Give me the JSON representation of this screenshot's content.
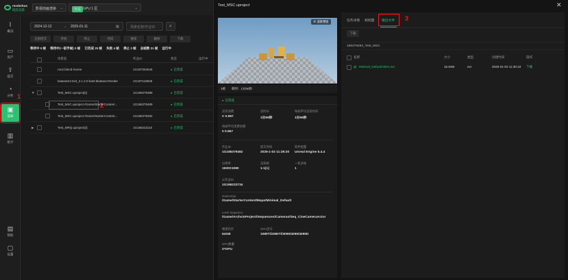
{
  "app": {
    "brand_en": "renderbus",
    "brand_cn": "瑞云渲染",
    "project_select": "影视动画渲染",
    "gpu_tag": "专属",
    "gpu_label": "GPU 1 区"
  },
  "sidebar": {
    "items": [
      {
        "label": "概况",
        "icon": "dashboard-icon"
      },
      {
        "label": "资产",
        "icon": "folder-icon"
      },
      {
        "label": "提交",
        "icon": "upload-icon"
      },
      {
        "label": "分析",
        "icon": "analysis-icon"
      },
      {
        "label": "渲染",
        "icon": "render-icon"
      },
      {
        "label": "统计",
        "icon": "chart-icon"
      },
      {
        "label": "帮助",
        "icon": "help-icon"
      },
      {
        "label": "设置",
        "icon": "settings-icon"
      }
    ]
  },
  "annotations": {
    "n1": "1",
    "n2": "2",
    "n3": "3"
  },
  "filter": {
    "date_from": "2024-12-12",
    "date_arrow": "→",
    "date_to": "2025-01-11",
    "search_placeholder": "场景名称/作业ID"
  },
  "toolbar": [
    "全部提交",
    "开始",
    "停止",
    "完成",
    "重提",
    "删除",
    "下载"
  ],
  "stats": {
    "waiting": "等待中 0 帧",
    "waiting_prev": "等待中(一前手帧) 0 帧",
    "done": "已完成 25 帧",
    "failed": "失败 4 帧",
    "stopped": "停止 2 帧",
    "total": "总帧数 31 帧",
    "running": "运行中"
  },
  "table": {
    "headers": [
      "场景名",
      "作业ID",
      "状态",
      "运行中"
    ],
    "rows": [
      {
        "name": "run2.blend-Scene",
        "id": "1G187253646",
        "status": "已完成",
        "expand": ""
      },
      {
        "name": "katanam3.0v3_2.1.2.0-kat3.6katana-Render",
        "id": "1G187118836",
        "status": "已完成",
        "expand": ""
      },
      {
        "name": "Test_MSC.uproject[2]",
        "id": "1G186379388",
        "status": "已完成",
        "expand": "▼"
      },
      {
        "name": "Test_MSC.uproject-/Game/StarterContent...",
        "id": "1G186379489",
        "status": "已完成",
        "expand": ""
      },
      {
        "name": "Test_MSC.uproject-/Game/StarterContent...",
        "id": "1G186379492",
        "status": "已完成",
        "expand": ""
      },
      {
        "name": "Test_MRQ.uproject[4]",
        "id": "1G186223110",
        "status": "已完成",
        "expand": "▶"
      }
    ]
  },
  "detail": {
    "title": "Test_MSC.uproject",
    "preview_badge": "⊕ 渲染预览",
    "caption_frame": "1帧",
    "caption_time": "耗时：1分56秒",
    "status": "已完成",
    "fields": [
      {
        "k": "实际消费",
        "v": "C 0.967"
      },
      {
        "k": "总时长",
        "v": "1分56秒"
      },
      {
        "k": "每帧平均渲染时间",
        "v": "1分56秒"
      },
      {
        "k": "每帧平均消费金额",
        "v": "¥ 0.967"
      },
      {
        "k": "作业ID",
        "v": "1G186379482"
      },
      {
        "k": "提交时间",
        "v": "2025-1-02 11:28:20"
      },
      {
        "k": "软件配置",
        "v": "Unreal Engine 5.4.4"
      },
      {
        "k": "分辨率",
        "v": "1920X1080"
      },
      {
        "k": "渲染帧",
        "v": "1-1[1]"
      },
      {
        "k": "一机多帧",
        "v": "1"
      },
      {
        "k": "父作业ID",
        "v": "1G186223734"
      },
      {
        "k": "Gamemap",
        "v": "/Game/StarterContent/Maps/Minimal_Default"
      },
      {
        "k": "Level Sequence",
        "v": "/Game/ArchvisProject/Sequences/Cameras/Seq_CineCameraActor"
      },
      {
        "k": "物理内存",
        "v": "64GB"
      },
      {
        "k": "GPU型号",
        "v": "1080Ti/2080Ti/3090/4090/4090D"
      },
      {
        "k": "GPU数量",
        "v": "2*GPU"
      }
    ]
  },
  "files": {
    "tabs": [
      "任务详情",
      "帧视图",
      "输出文件"
    ],
    "download_label": "下载",
    "path": "186379492_Test_MSC",
    "headers": [
      "名称",
      "大小",
      "类型",
      "创建时间",
      "操作"
    ],
    "rows": [
      {
        "name": "Minimal_Default.0001.exr",
        "size": "15.84M",
        "type": "exr",
        "time": "2025-01-02 11:30:43",
        "action": "下载"
      }
    ]
  },
  "colors": {
    "accent": "#2fbf71",
    "annotation": "#e02020"
  }
}
